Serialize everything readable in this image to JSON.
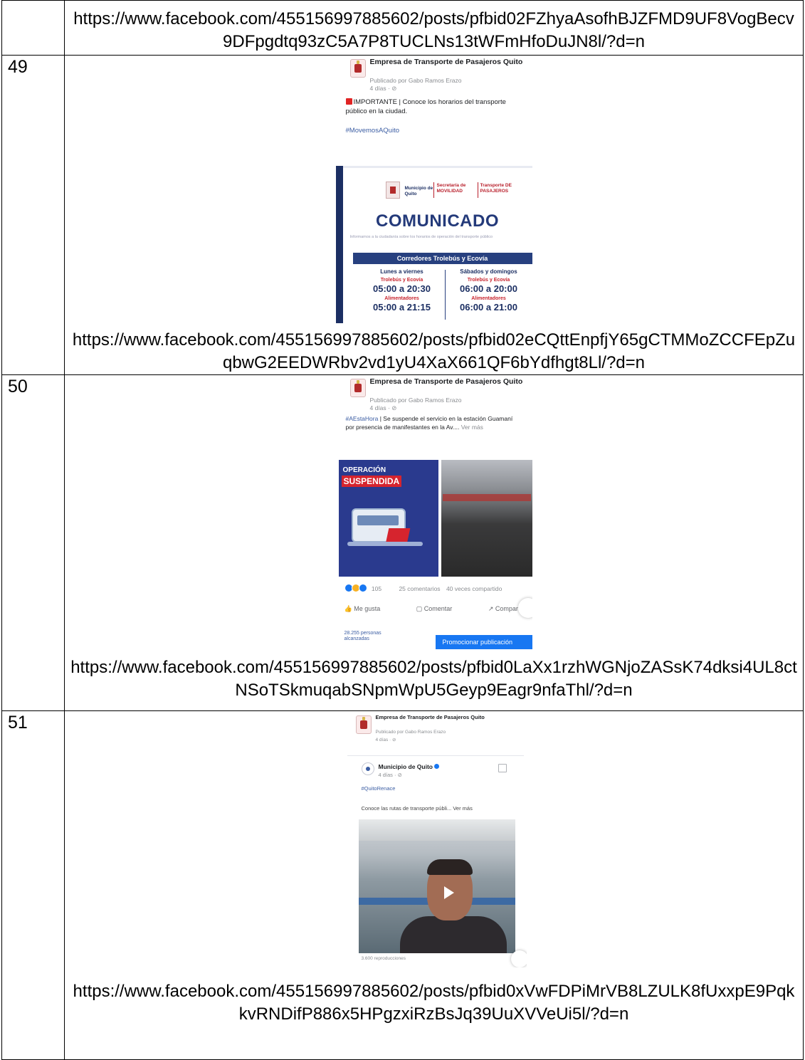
{
  "rows": [
    {
      "url": "https://www.facebook.com/455156997885602/posts/pfbid02FZhyaAsofhBJZFMD9UF8VogBecv9DFpgdtq93zC5A7P8TUCLNs13tWFmHfoDuJN8l/?d=n"
    },
    {
      "number": "49",
      "post": {
        "page_name": "Empresa de Transporte de Pasajeros Quito",
        "published_by": "Publicado por Gabo Ramos Erazo",
        "age": "4 días · ⊘",
        "text_prefix": "IMPORTANTE | Conoce los horarios del transporte público en la ciudad.",
        "hashtag": "#MovemosAQuito",
        "poster": {
          "logo_left": "Municipio de Quito",
          "logo_mid": "Secretaría de MOVILIDAD",
          "logo_right": "Transporte DE PASAJEROS",
          "heading": "COMUNICADO",
          "intro": "Informamos a la ciudadanía sobre los horarios de operación del transporte público",
          "banner": "Corredores Trolebús y Ecovía",
          "col_a": {
            "day": "Lunes a viernes",
            "line1": "Trolebús y Ecovía",
            "hours1": "05:00 a 20:30",
            "line2": "Alimentadores",
            "hours2": "05:00 a 21:15"
          },
          "col_b": {
            "day": "Sábados y domingos",
            "line1": "Trolebús y Ecovía",
            "hours1": "06:00 a 20:00",
            "line2": "Alimentadores",
            "hours2": "06:00 a 21:00"
          }
        }
      },
      "url": "https://www.facebook.com/455156997885602/posts/pfbid02eCQttEnpfjY65gCTMMoZCCFEpZuqbwG2EEDWRbv2vd1yU4XaX661QF6bYdfhgt8Ll/?d=n"
    },
    {
      "number": "50",
      "post": {
        "page_name": "Empresa de Transporte de Pasajeros Quito",
        "published_by": "Publicado por Gabo Ramos Erazo",
        "age": "4 días · ⊘",
        "hashtag": "#AEstaHora",
        "text": " | Se suspende el servicio en la estación Guamaní por presencia de manifestantes en la Av.... ",
        "see_more": "Ver más",
        "op_title": "OPERACIÓN",
        "op_subtitle": "SUSPENDIDA",
        "reactions_count": "105",
        "comments": "25 comentarios",
        "shares": "40 veces compartido",
        "like": "Me gusta",
        "comment": "Comentar",
        "share": "Compartir",
        "reach": "28.255 personas alcanzadas",
        "promote": "Promocionar publicación"
      },
      "url": "https://www.facebook.com/455156997885602/posts/pfbid0LaXx1rzhWGNjoZASsK74dksi4UL8ctNSoTSkmuqabSNpmWpU5Geyp9Eagr9nfaThl/?d=n"
    },
    {
      "number": "51",
      "post": {
        "page_name": "Empresa de Transporte de Pasajeros Quito",
        "published_by": "Publicado por Gabo Ramos Erazo",
        "age": "4 días · ⊘",
        "shared_page": "Municipio de Quito",
        "shared_age": "4 días · ⊘",
        "hashtag": "#QuitoRenace",
        "text": "Conoce las rutas de transporte públi... Ver más",
        "views": "3.600 reproducciones"
      },
      "url": "https://www.facebook.com/455156997885602/posts/pfbid0xVwFDPiMrVB8LZULK8fUxxpE9PqkkvRNDifP886x5HPgzxiRzBsJq39UuXVVeUi5l/?d=n"
    }
  ]
}
